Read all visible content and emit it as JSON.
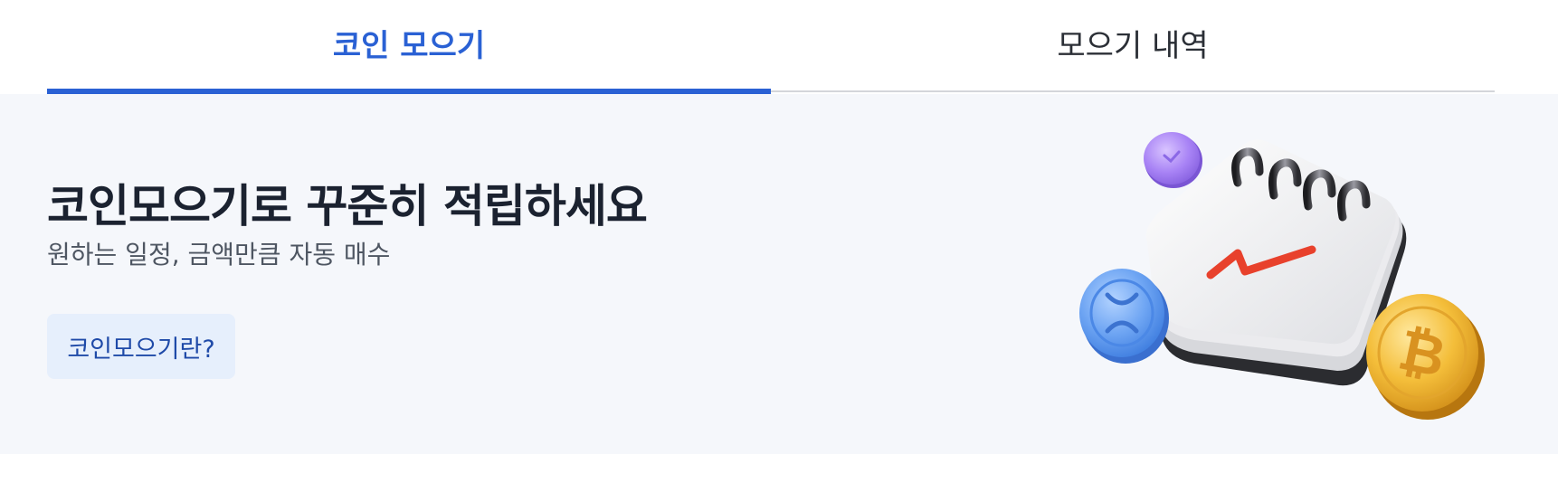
{
  "tabs": [
    {
      "label": "코인 모으기",
      "active": true
    },
    {
      "label": "모으기 내역",
      "active": false
    }
  ],
  "banner": {
    "headline": "코인모으기로 꾸준히 적립하세요",
    "subline": "원하는 일정, 금액만큼 자동 매수",
    "info_button_label": "코인모으기란?"
  },
  "illustration": {
    "icons": [
      "purple-coin-icon",
      "calendar-icon",
      "xrp-coin-icon",
      "bitcoin-coin-icon"
    ]
  },
  "colors": {
    "accent": "#2a61d4",
    "banner_bg": "#f5f7fb",
    "button_bg": "#e6effc",
    "headline": "#1b2230"
  }
}
